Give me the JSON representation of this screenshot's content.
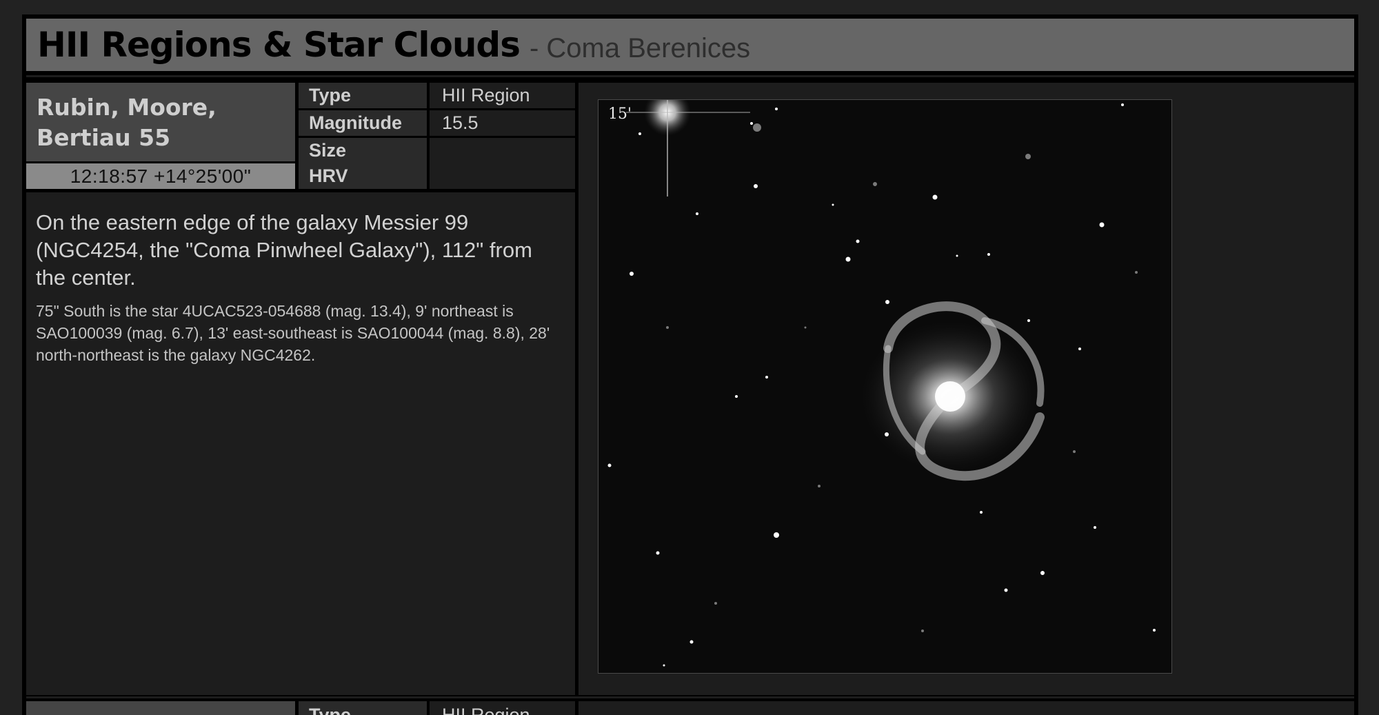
{
  "header": {
    "title": "HII Regions & Star Clouds",
    "subtitle": "- Coma Berenices"
  },
  "entry": {
    "name_line1": "Rubin, Moore,",
    "name_line2": "Bertiau 55",
    "coordinates": "12:18:57 +14°25'00\"",
    "attributes": [
      {
        "key": "Type",
        "value": "HII Region"
      },
      {
        "key": "Magnitude",
        "value": "15.5"
      },
      {
        "key": "Size",
        "value": ""
      },
      {
        "key": "HRV",
        "value": ""
      }
    ],
    "description": "On the eastern edge of the galaxy Messier 99 (NGC4254, the \"Coma Pinwheel Galaxy\"), 112\" from the center.",
    "notes": "75\" South is the star 4UCAC523-054688 (mag. 13.4), 9' northeast is SAO100039 (mag. 6.7), 13' east-southeast is SAO100044 (mag. 8.8), 28' north-northeast is the galaxy NGC4262.",
    "image_scale_label": "15'"
  },
  "next_entry": {
    "type_key": "Type",
    "type_value": "HII Region"
  },
  "colors": {
    "title_bar": "#666666",
    "name_box": "#454545",
    "coord_box": "#8a8a8a",
    "panel": "#1d1d1d"
  }
}
